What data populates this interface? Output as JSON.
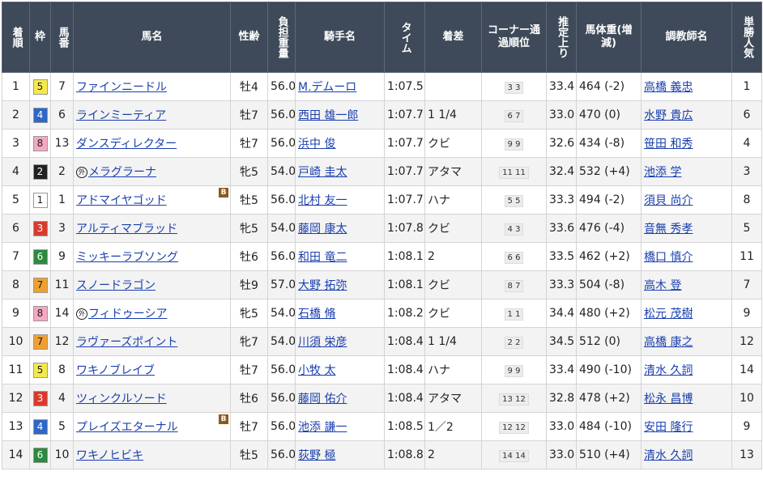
{
  "headers": [
    "着順",
    "枠",
    "馬番",
    "馬名",
    "性齢",
    "負担重量",
    "騎手名",
    "タイム",
    "着差",
    "コーナー通過順位",
    "推定上り",
    "馬体重(増減)",
    "調教師名",
    "単勝人気"
  ],
  "waku_colors": {
    "1": {
      "bg": "#ffffff",
      "fg": "#222222"
    },
    "2": {
      "bg": "#222222",
      "fg": "#ffffff"
    },
    "3": {
      "bg": "#d93a2e",
      "fg": "#ffffff"
    },
    "4": {
      "bg": "#2e67c7",
      "fg": "#ffffff"
    },
    "5": {
      "bg": "#f5e94a",
      "fg": "#222222"
    },
    "6": {
      "bg": "#2d8a3e",
      "fg": "#ffffff"
    },
    "7": {
      "bg": "#f0a030",
      "fg": "#222222"
    },
    "8": {
      "bg": "#f5a8c2",
      "fg": "#222222"
    }
  },
  "link_color": "#1a3fae",
  "header_bg": "#3e4a59",
  "rows": [
    {
      "rank": "1",
      "waku": "5",
      "num": "7",
      "name": "ファインニードル",
      "foreign": false,
      "blinker": false,
      "sexage": "牡4",
      "weight": "56.0",
      "jockey": "M.デムーロ",
      "time": "1:07.5",
      "margin": "",
      "corner": "3 3",
      "last3f": "33.4",
      "bodyweight": "464 (-2)",
      "trainer": "高橋 義忠",
      "popularity": "1"
    },
    {
      "rank": "2",
      "waku": "4",
      "num": "6",
      "name": "ラインミーティア",
      "foreign": false,
      "blinker": false,
      "sexage": "牡7",
      "weight": "56.0",
      "jockey": "西田 雄一郎",
      "time": "1:07.7",
      "margin": "1 1/4",
      "corner": "6 7",
      "last3f": "33.0",
      "bodyweight": "470 (0)",
      "trainer": "水野 貴広",
      "popularity": "6"
    },
    {
      "rank": "3",
      "waku": "8",
      "num": "13",
      "name": "ダンスディレクター",
      "foreign": false,
      "blinker": false,
      "sexage": "牡7",
      "weight": "56.0",
      "jockey": "浜中 俊",
      "time": "1:07.7",
      "margin": "クビ",
      "corner": "9 9",
      "last3f": "32.6",
      "bodyweight": "434 (-8)",
      "trainer": "笹田 和秀",
      "popularity": "4"
    },
    {
      "rank": "4",
      "waku": "2",
      "num": "2",
      "name": "メラグラーナ",
      "foreign": true,
      "blinker": false,
      "sexage": "牝5",
      "weight": "54.0",
      "jockey": "戸崎 圭太",
      "time": "1:07.7",
      "margin": "アタマ",
      "corner": "11 11",
      "last3f": "32.4",
      "bodyweight": "532 (+4)",
      "trainer": "池添 学",
      "popularity": "3"
    },
    {
      "rank": "5",
      "waku": "1",
      "num": "1",
      "name": "アドマイヤゴッド",
      "foreign": false,
      "blinker": true,
      "sexage": "牡5",
      "weight": "56.0",
      "jockey": "北村 友一",
      "time": "1:07.7",
      "margin": "ハナ",
      "corner": "5 5",
      "last3f": "33.3",
      "bodyweight": "494 (-2)",
      "trainer": "須貝 尚介",
      "popularity": "8"
    },
    {
      "rank": "6",
      "waku": "3",
      "num": "3",
      "name": "アルティマブラッド",
      "foreign": false,
      "blinker": false,
      "sexage": "牝5",
      "weight": "54.0",
      "jockey": "藤岡 康太",
      "time": "1:07.8",
      "margin": "クビ",
      "corner": "4 3",
      "last3f": "33.6",
      "bodyweight": "476 (-4)",
      "trainer": "音無 秀孝",
      "popularity": "5"
    },
    {
      "rank": "7",
      "waku": "6",
      "num": "9",
      "name": "ミッキーラブソング",
      "foreign": false,
      "blinker": false,
      "sexage": "牡6",
      "weight": "56.0",
      "jockey": "和田 竜二",
      "time": "1:08.1",
      "margin": "2",
      "corner": "6 6",
      "last3f": "33.5",
      "bodyweight": "462 (+2)",
      "trainer": "橋口 慎介",
      "popularity": "11"
    },
    {
      "rank": "8",
      "waku": "7",
      "num": "11",
      "name": "スノードラゴン",
      "foreign": false,
      "blinker": false,
      "sexage": "牡9",
      "weight": "57.0",
      "jockey": "大野 拓弥",
      "time": "1:08.1",
      "margin": "クビ",
      "corner": "8 7",
      "last3f": "33.3",
      "bodyweight": "504 (-8)",
      "trainer": "高木 登",
      "popularity": "7"
    },
    {
      "rank": "9",
      "waku": "8",
      "num": "14",
      "name": "フィドゥーシア",
      "foreign": true,
      "blinker": false,
      "sexage": "牝5",
      "weight": "54.0",
      "jockey": "石橋 脩",
      "time": "1:08.2",
      "margin": "クビ",
      "corner": "1 1",
      "last3f": "34.4",
      "bodyweight": "480 (+2)",
      "trainer": "松元 茂樹",
      "popularity": "9"
    },
    {
      "rank": "10",
      "waku": "7",
      "num": "12",
      "name": "ラヴァーズポイント",
      "foreign": false,
      "blinker": false,
      "sexage": "牝7",
      "weight": "54.0",
      "jockey": "川須 栄彦",
      "time": "1:08.4",
      "margin": "1 1/4",
      "corner": "2 2",
      "last3f": "34.5",
      "bodyweight": "512 (0)",
      "trainer": "高橋 康之",
      "popularity": "12"
    },
    {
      "rank": "11",
      "waku": "5",
      "num": "8",
      "name": "ワキノブレイブ",
      "foreign": false,
      "blinker": false,
      "sexage": "牡7",
      "weight": "56.0",
      "jockey": "小牧 太",
      "time": "1:08.4",
      "margin": "ハナ",
      "corner": "9 9",
      "last3f": "33.4",
      "bodyweight": "490 (-10)",
      "trainer": "清水 久詞",
      "popularity": "14"
    },
    {
      "rank": "12",
      "waku": "3",
      "num": "4",
      "name": "ツィンクルソード",
      "foreign": false,
      "blinker": false,
      "sexage": "牡6",
      "weight": "56.0",
      "jockey": "藤岡 佑介",
      "time": "1:08.4",
      "margin": "アタマ",
      "corner": "13 12",
      "last3f": "32.8",
      "bodyweight": "478 (+2)",
      "trainer": "松永 昌博",
      "popularity": "10"
    },
    {
      "rank": "13",
      "waku": "4",
      "num": "5",
      "name": "プレイズエターナル",
      "foreign": false,
      "blinker": true,
      "sexage": "牡7",
      "weight": "56.0",
      "jockey": "池添 謙一",
      "time": "1:08.5",
      "margin": "1／2",
      "corner": "12 12",
      "last3f": "33.0",
      "bodyweight": "484 (-10)",
      "trainer": "安田 隆行",
      "popularity": "9"
    },
    {
      "rank": "14",
      "waku": "6",
      "num": "10",
      "name": "ワキノヒビキ",
      "foreign": false,
      "blinker": false,
      "sexage": "牡5",
      "weight": "56.0",
      "jockey": "荻野 極",
      "time": "1:08.8",
      "margin": "2",
      "corner": "14 14",
      "last3f": "33.0",
      "bodyweight": "510 (+4)",
      "trainer": "清水 久詞",
      "popularity": "13"
    }
  ],
  "icons": {
    "foreign": "外",
    "blinker": "B"
  }
}
